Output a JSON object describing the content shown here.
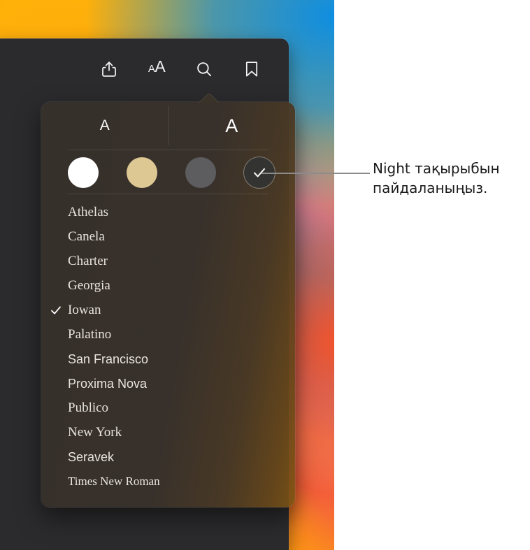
{
  "colors": {
    "window_bg": "#2b2b2d",
    "popover_bg": "#37302a",
    "text_primary": "#e8e4df",
    "callout_line": "#8c8c8c",
    "callout_text": "#1b1b1b",
    "backdrop_orange": "#ffb008",
    "backdrop_blue": "#0f8ee0",
    "backdrop_red": "#f4522a"
  },
  "toolbar": {
    "buttons": [
      {
        "name": "share-icon",
        "label": "Share"
      },
      {
        "name": "text-size-icon",
        "label": "AA",
        "small_a": "A",
        "large_a": "A"
      },
      {
        "name": "search-icon",
        "label": "Search"
      },
      {
        "name": "bookmark-icon",
        "label": "Bookmark"
      }
    ]
  },
  "popover": {
    "size_controls": {
      "decrease_label": "A",
      "increase_label": "A"
    },
    "themes": [
      {
        "name": "theme-white",
        "label": "White",
        "color": "#ffffff",
        "selected": false
      },
      {
        "name": "theme-sepia",
        "label": "Sepia",
        "color": "#ddc894",
        "selected": false
      },
      {
        "name": "theme-gray",
        "label": "Gray",
        "color": "#5d5d5f",
        "selected": false
      },
      {
        "name": "theme-night",
        "label": "Night",
        "color": "#333331",
        "selected": true
      }
    ],
    "fonts": [
      {
        "label": "Athelas",
        "style": "serif",
        "selected": false
      },
      {
        "label": "Canela",
        "style": "serif",
        "selected": false
      },
      {
        "label": "Charter",
        "style": "serif",
        "selected": false
      },
      {
        "label": "Georgia",
        "style": "serif",
        "selected": false
      },
      {
        "label": "Iowan",
        "style": "serif",
        "selected": true
      },
      {
        "label": "Palatino",
        "style": "serif",
        "selected": false
      },
      {
        "label": "San Francisco",
        "style": "sans",
        "selected": false
      },
      {
        "label": "Proxima Nova",
        "style": "sans",
        "selected": false
      },
      {
        "label": "Publico",
        "style": "serif",
        "selected": false
      },
      {
        "label": "New York",
        "style": "serif",
        "selected": false
      },
      {
        "label": "Seravek",
        "style": "sans",
        "selected": false
      },
      {
        "label": "Times New Roman",
        "style": "tnr",
        "selected": false
      }
    ]
  },
  "callout": {
    "line1": "Night тақырыбын",
    "line2": "пайдаланыңыз.",
    "full_text": "Night тақырыбын пайдаланыңыз."
  }
}
